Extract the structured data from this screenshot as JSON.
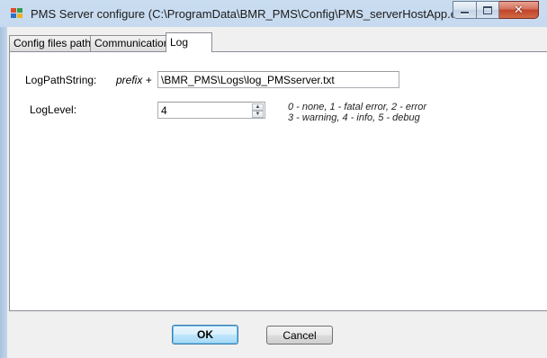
{
  "window": {
    "title": "PMS Server configure (C:\\ProgramData\\BMR_PMS\\Config\\PMS_serverHostApp.exe.conf...",
    "minimize_glyph": "minimize-icon",
    "maximize_glyph": "maximize-icon",
    "close_glyph": "✕"
  },
  "tabs": [
    {
      "label": "Config files path",
      "selected": false
    },
    {
      "label": "Communication",
      "selected": false
    },
    {
      "label": "Log",
      "selected": true
    }
  ],
  "log": {
    "path_label": "LogPathString:",
    "prefix_label": "prefix +",
    "path_value": "\\BMR_PMS\\Logs\\log_PMSserver.txt",
    "level_label": "LogLevel:",
    "level_value": "4",
    "level_hint_line1": "0 - none, 1 - fatal error, 2 - error",
    "level_hint_line2": "3 - warning, 4 - info, 5 - debug"
  },
  "buttons": {
    "ok": "OK",
    "cancel": "Cancel"
  },
  "colors": {
    "frame": "#bcd2ea",
    "close_button": "#c2442b",
    "default_button_border": "#3c7fb1"
  }
}
